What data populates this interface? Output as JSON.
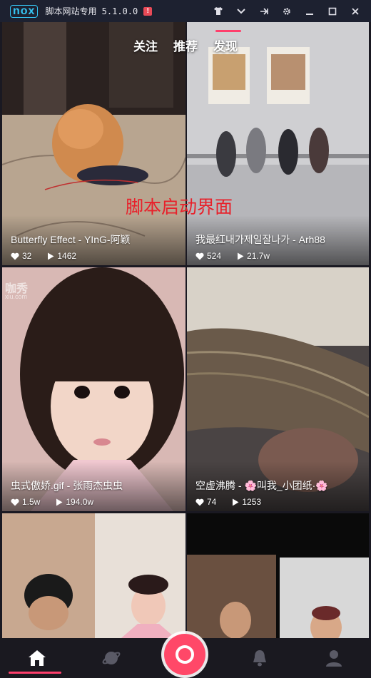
{
  "titlebar": {
    "logo": "nox",
    "title": "脚本网站专用 5.1.0.0",
    "warning": "!",
    "controls": [
      "shirt-icon",
      "chevron-down-icon",
      "pin-icon",
      "gear-icon",
      "minimize-icon",
      "maximize-icon",
      "close-icon"
    ]
  },
  "topnav": {
    "tabs": [
      "关注",
      "推荐",
      "发现"
    ],
    "active": "发现",
    "accent": "#ff3f6c"
  },
  "overlay": "脚本启动界面",
  "cards": [
    {
      "title": "Butterfly Effect - YInG-阿颖",
      "likes": "32",
      "plays": "1462"
    },
    {
      "title": "我最红내가제일잘나가 - Arh88",
      "likes": "524",
      "plays": "21.7w"
    },
    {
      "title": "虫式傲娇.gif - 张雨杰虫虫",
      "likes": "1.5w",
      "plays": "194.0w",
      "watermark": "咖秀",
      "watermark_sub": "xiu.com"
    },
    {
      "title": "空虚沸腾 - 🌸叫我_小团纸·🌸",
      "likes": "74",
      "plays": "1253"
    },
    {
      "title": "",
      "likes": "",
      "plays": ""
    },
    {
      "title": "",
      "likes": "",
      "plays": ""
    }
  ],
  "card2_watermark": "咖秀",
  "bottombar": {
    "tabs": [
      "home-icon",
      "planet-icon",
      "record-button",
      "bell-icon",
      "profile-icon"
    ],
    "active": "home-icon"
  }
}
